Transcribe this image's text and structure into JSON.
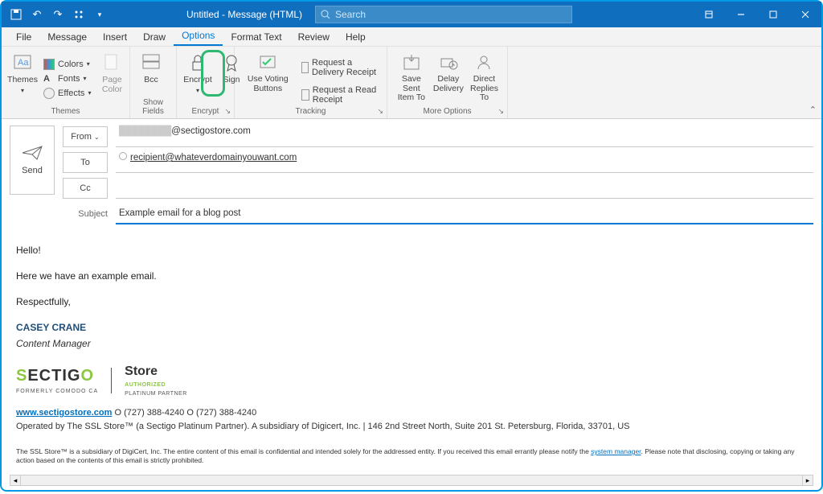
{
  "titlebar": {
    "title": "Untitled - Message (HTML)",
    "search_placeholder": "Search"
  },
  "menubar": {
    "items": [
      "File",
      "Message",
      "Insert",
      "Draw",
      "Options",
      "Format Text",
      "Review",
      "Help"
    ],
    "active_index": 4
  },
  "ribbon": {
    "themes": {
      "label": "Themes",
      "themes_btn": "Themes",
      "colors": "Colors",
      "fonts": "Fonts",
      "effects": "Effects",
      "page_color": "Page Color"
    },
    "show_fields": {
      "label": "Show Fields",
      "bcc": "Bcc"
    },
    "encrypt": {
      "label": "Encrypt",
      "encrypt": "Encrypt",
      "sign": "Sign"
    },
    "tracking": {
      "label": "Tracking",
      "voting": "Use Voting Buttons",
      "delivery": "Request a Delivery Receipt",
      "read": "Request a Read Receipt"
    },
    "more": {
      "label": "More Options",
      "save_sent": "Save Sent Item To",
      "delay": "Delay Delivery",
      "direct": "Direct Replies To"
    }
  },
  "compose": {
    "send": "Send",
    "from": "From",
    "from_value": "@sectigostore.com",
    "to": "To",
    "to_value": "recipient@whateverdomainyouwant.com",
    "cc": "Cc",
    "subject_label": "Subject",
    "subject_value": "Example email for a blog post"
  },
  "body": {
    "greeting": "Hello!",
    "line1": "Here we have an example email.",
    "closing": "Respectfully,",
    "sig_name": "CASEY CRANE",
    "sig_title": "Content Manager",
    "logo_text": "SECTIGO",
    "logo_sub": "FORMERLY COMODO CA",
    "store": "Store",
    "store_auth": "AUTHORIZED",
    "store_plat": "PLATINUM PARTNER",
    "url": "www.sectigostore.com",
    "phones": " O (727) 388-4240 O (727) 388-4240",
    "address": "Operated by The SSL Store™ (a Sectigo Platinum Partner).   A subsidiary of Digicert, Inc. | 146 2nd Street North, Suite 201 St. Petersburg, Florida, 33701, US",
    "disclaimer_pre": "The SSL Store™ is a subsidiary of DigiCert, Inc. The entire content of this email is confidential and intended solely for the addressed entity. If you received this email errantly please notify the ",
    "disclaimer_link": "system manager",
    "disclaimer_post": ". Please note that disclosing, copying or taking any action based on the contents of this email is strictly prohibited."
  }
}
